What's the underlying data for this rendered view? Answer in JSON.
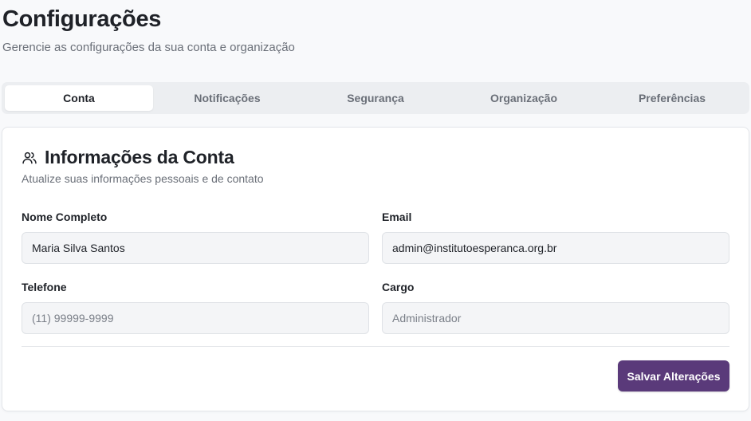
{
  "header": {
    "title": "Configurações",
    "subtitle": "Gerencie as configurações da sua conta e organização"
  },
  "tabs": [
    {
      "label": "Conta",
      "active": true
    },
    {
      "label": "Notificações",
      "active": false
    },
    {
      "label": "Segurança",
      "active": false
    },
    {
      "label": "Organização",
      "active": false
    },
    {
      "label": "Preferências",
      "active": false
    }
  ],
  "account_card": {
    "icon": "users-icon",
    "title": "Informações da Conta",
    "description": "Atualize suas informações pessoais e de contato",
    "fields": {
      "name": {
        "label": "Nome Completo",
        "value": "Maria Silva Santos",
        "placeholder": ""
      },
      "email": {
        "label": "Email",
        "value": "admin@institutoesperanca.org.br",
        "placeholder": ""
      },
      "phone": {
        "label": "Telefone",
        "value": "",
        "placeholder": "(11) 99999-9999"
      },
      "role": {
        "label": "Cargo",
        "value": "",
        "placeholder": "Administrador"
      }
    },
    "save_label": "Salvar Alterações"
  },
  "colors": {
    "accent": "#5a3a7a",
    "background": "#f8f9fb",
    "tab_bar": "#eceef1"
  }
}
